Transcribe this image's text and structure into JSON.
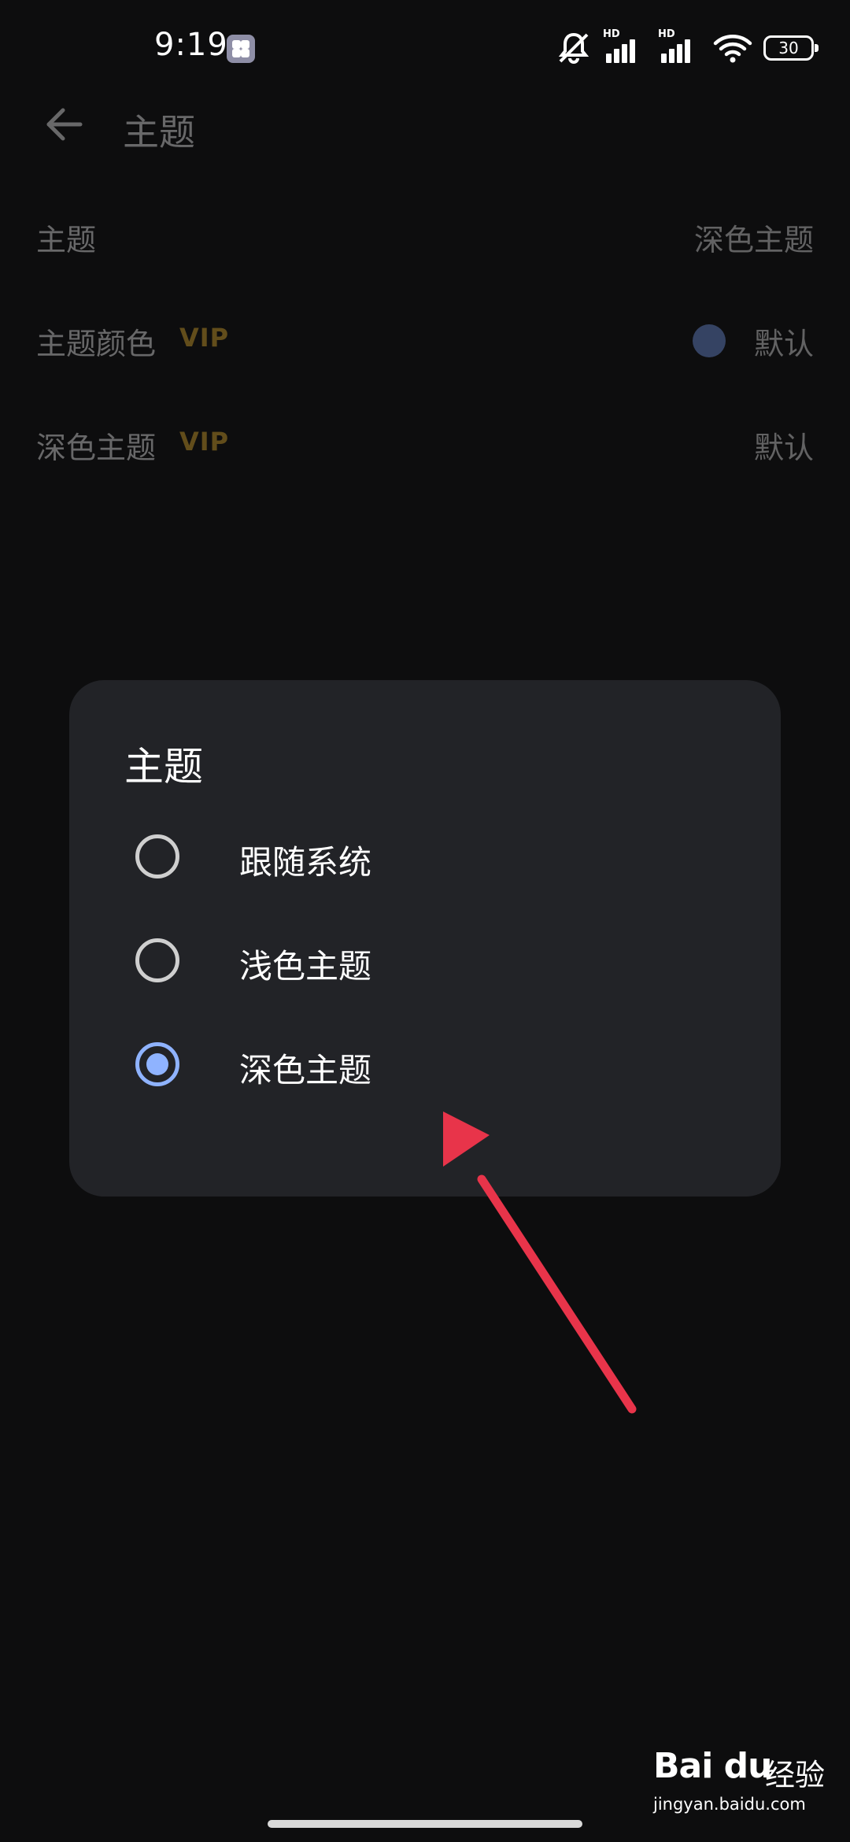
{
  "status_bar": {
    "time": "9:19",
    "hd_label": "HD",
    "battery": "30"
  },
  "header": {
    "title": "主题"
  },
  "settings": {
    "rows": [
      {
        "label": "主题",
        "value": "深色主题"
      },
      {
        "label": "主题颜色",
        "badge": "VIP",
        "value": "默认"
      },
      {
        "label": "深色主题",
        "badge": "VIP",
        "value": "默认"
      }
    ]
  },
  "dialog": {
    "title": "主题",
    "options": [
      {
        "label": "跟随系统",
        "selected": false
      },
      {
        "label": "浅色主题",
        "selected": false
      },
      {
        "label": "深色主题",
        "selected": true
      }
    ]
  },
  "annotation": {
    "arrow_color": "#e8344a"
  },
  "watermark": {
    "logo": "Bai du",
    "brand": "经验",
    "url": "jingyan.baidu.com"
  },
  "colors": {
    "background": "#0d0d0e",
    "dialog": "#222327",
    "accent": "#8fb3ff",
    "vip": "#d8a62e"
  }
}
